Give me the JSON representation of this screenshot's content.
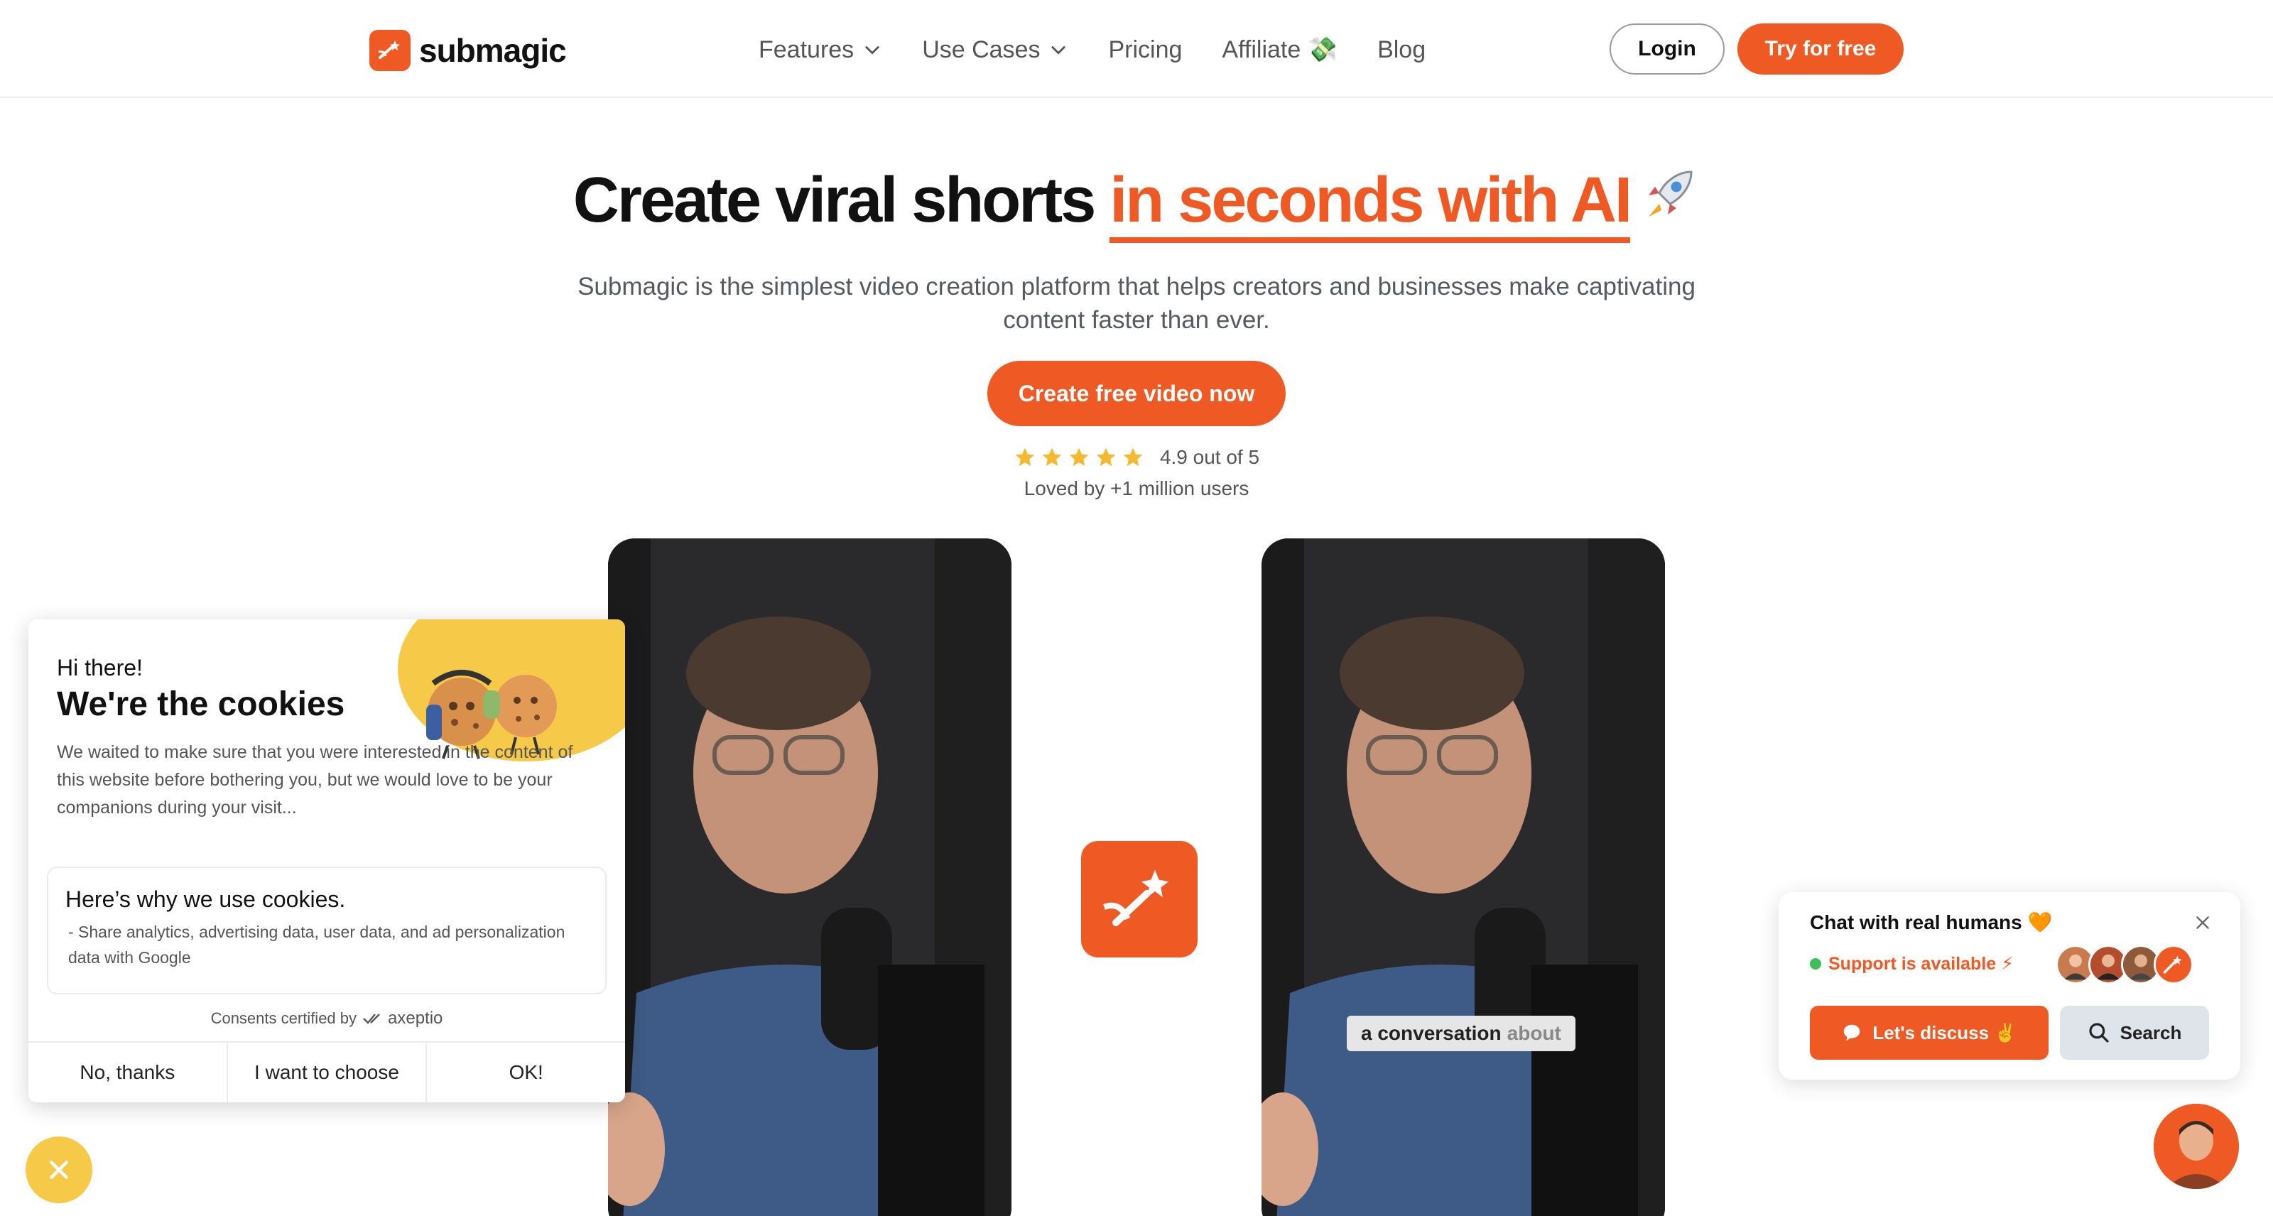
{
  "brand": {
    "name": "submagic",
    "accent": "#ef5a24"
  },
  "nav": {
    "items": [
      {
        "label": "Features",
        "dropdown": true
      },
      {
        "label": "Use Cases",
        "dropdown": true
      },
      {
        "label": "Pricing",
        "dropdown": false
      },
      {
        "label": "Affiliate 💸",
        "dropdown": false
      },
      {
        "label": "Blog",
        "dropdown": false
      }
    ],
    "login_label": "Login",
    "try_label": "Try for free"
  },
  "hero": {
    "title_plain": "Create viral shorts ",
    "title_accent": "in seconds with AI",
    "subtitle": "Submagic is the simplest video creation platform that helps creators and businesses make captivating content faster than ever.",
    "cta_label": "Create free video now",
    "rating_stars": 5,
    "rating_text": "4.9 out of 5",
    "loved_text": "Loved by +1 million users"
  },
  "videos": {
    "caption_bold": "a conversation",
    "caption_muted": "about"
  },
  "cookie": {
    "greeting": "Hi there!",
    "title": "We're the cookies",
    "body": "We waited to make sure that you were interested in the content of this website before bothering you, but we would love to be your companions during your visit...",
    "why_title": "Here’s why we use cookies.",
    "why_item": "- Share analytics, advertising data, user data, and ad personalization data with Google",
    "certified_text": "Consents certified by",
    "certifier": "axeptio",
    "buttons": {
      "no": "No, thanks",
      "choose": "I want to choose",
      "ok": "OK!"
    }
  },
  "chat": {
    "title": "Chat with real humans 🧡",
    "status": "Support is available ⚡",
    "discuss_label": "Let's discuss ✌️",
    "search_label": "Search"
  },
  "icons": {
    "nav_chevron": "chevron-down-icon",
    "rating": "star-icon",
    "hero_emoji": "rocket-icon",
    "chat_close": "close-icon",
    "search": "search-icon"
  }
}
